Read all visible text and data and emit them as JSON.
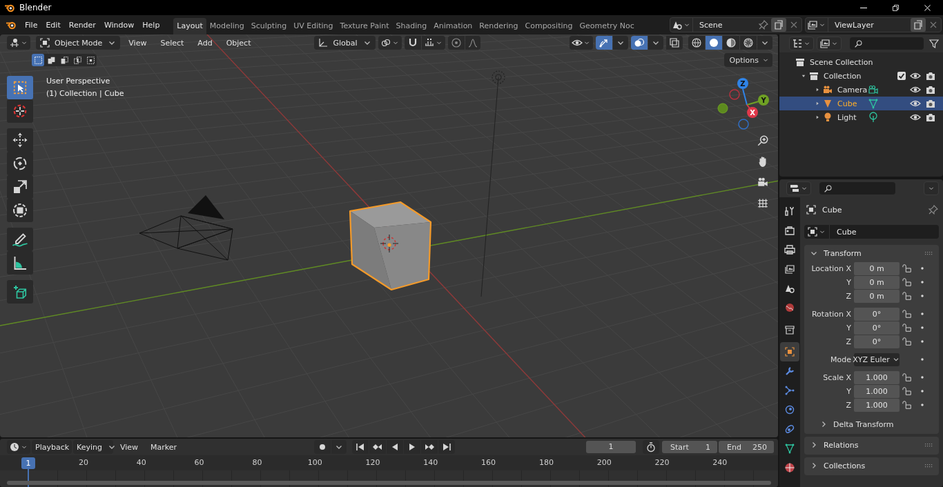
{
  "window": {
    "title": "Blender"
  },
  "menu": [
    "File",
    "Edit",
    "Render",
    "Window",
    "Help"
  ],
  "workspaces": [
    {
      "label": "Layout",
      "selected": true
    },
    {
      "label": "Modeling",
      "selected": false
    },
    {
      "label": "Sculpting",
      "selected": false
    },
    {
      "label": "UV Editing",
      "selected": false
    },
    {
      "label": "Texture Paint",
      "selected": false
    },
    {
      "label": "Shading",
      "selected": false
    },
    {
      "label": "Animation",
      "selected": false
    },
    {
      "label": "Rendering",
      "selected": false
    },
    {
      "label": "Compositing",
      "selected": false
    },
    {
      "label": "Geometry Noc",
      "selected": false
    }
  ],
  "scene": {
    "value": "Scene"
  },
  "view_layer": {
    "value": "ViewLayer"
  },
  "viewport": {
    "mode": "Object Mode",
    "menus": [
      "View",
      "Select",
      "Add",
      "Object"
    ],
    "orientation": "Global",
    "options": "Options",
    "select_modes": [
      {
        "selected": true
      },
      {
        "selected": false
      },
      {
        "selected": false
      },
      {
        "selected": false
      },
      {
        "selected": false
      }
    ],
    "toggles": [
      {
        "kind": "gizmos",
        "on": true
      },
      {
        "kind": "overlays",
        "on": true
      },
      {
        "kind": "xray",
        "on": false
      }
    ],
    "shading": [
      {
        "kind": "wireframe",
        "selected": false
      },
      {
        "kind": "solid",
        "selected": true
      },
      {
        "kind": "material",
        "selected": false
      },
      {
        "kind": "rendered",
        "selected": false
      }
    ],
    "info": [
      "User Perspective",
      "(1) Collection | Cube"
    ],
    "tools": [
      {
        "kind": "select",
        "selected": true
      },
      {
        "kind": "cursor",
        "selected": false
      },
      {
        "kind": "move",
        "selected": false
      },
      {
        "kind": "rotate",
        "selected": false
      },
      {
        "kind": "scale",
        "selected": false
      },
      {
        "kind": "transform",
        "selected": false
      },
      {
        "kind": "annotate",
        "selected": false
      },
      {
        "kind": "measure",
        "selected": false
      },
      {
        "kind": "add_cube",
        "selected": false
      }
    ],
    "axes": {
      "x": "X",
      "y": "Y",
      "z": "Z"
    }
  },
  "outliner": {
    "tree": [
      {
        "label": "Scene Collection",
        "kind": "scene",
        "selected": false,
        "children": [
          {
            "label": "Collection",
            "kind": "collection",
            "selected": false,
            "expanded": true,
            "checked": true,
            "children": [
              {
                "label": "Camera",
                "kind": "camera",
                "selected": false,
                "expanded": false
              },
              {
                "label": "Cube",
                "kind": "mesh",
                "selected": true,
                "expanded": false
              },
              {
                "label": "Light",
                "kind": "light",
                "selected": false,
                "expanded": false
              }
            ]
          }
        ]
      }
    ]
  },
  "properties": {
    "tabs": [
      {
        "kind": "tool",
        "selected": false
      },
      {
        "kind": "render",
        "selected": false
      },
      {
        "kind": "output",
        "selected": false
      },
      {
        "kind": "view_layer",
        "selected": false
      },
      {
        "kind": "scene",
        "selected": false
      },
      {
        "kind": "world",
        "selected": false
      },
      {
        "kind": "collection",
        "selected": false
      },
      {
        "kind": "object",
        "selected": true
      },
      {
        "kind": "modifiers",
        "selected": false
      },
      {
        "kind": "particles",
        "selected": false
      },
      {
        "kind": "physics",
        "selected": false
      },
      {
        "kind": "constraints",
        "selected": false
      },
      {
        "kind": "data",
        "selected": false
      },
      {
        "kind": "material",
        "selected": false
      }
    ],
    "object": "Cube",
    "name_field": "Cube",
    "panels": [
      {
        "title": "Transform",
        "expanded": true,
        "groups": [
          [
            {
              "label": "Location X",
              "value": "0 m",
              "kind": "field"
            },
            {
              "label": "Y",
              "value": "0 m",
              "kind": "field"
            },
            {
              "label": "Z",
              "value": "0 m",
              "kind": "field"
            }
          ],
          [
            {
              "label": "Rotation X",
              "value": "0°",
              "kind": "field"
            },
            {
              "label": "Y",
              "value": "0°",
              "kind": "field"
            },
            {
              "label": "Z",
              "value": "0°",
              "kind": "field"
            }
          ],
          [
            {
              "label": "Mode",
              "value": "XYZ Euler",
              "kind": "dropdown"
            }
          ],
          [
            {
              "label": "Scale X",
              "value": "1.000",
              "kind": "field"
            },
            {
              "label": "Y",
              "value": "1.000",
              "kind": "field"
            },
            {
              "label": "Z",
              "value": "1.000",
              "kind": "field"
            }
          ]
        ],
        "subpanels": [
          {
            "title": "Delta Transform",
            "expanded": false
          }
        ]
      },
      {
        "title": "Relations",
        "expanded": false
      },
      {
        "title": "Collections",
        "expanded": false
      }
    ]
  },
  "timeline": {
    "menus": [
      "Playback",
      "Keying"
    ],
    "items": [
      "View",
      "Marker"
    ],
    "current_frame": "1",
    "start": {
      "label": "Start",
      "value": "1"
    },
    "end": {
      "label": "End",
      "value": "250"
    },
    "playhead": "1",
    "ticks": [
      "20",
      "40",
      "60",
      "80",
      "100",
      "120",
      "140",
      "160",
      "180",
      "200",
      "220",
      "240"
    ]
  }
}
